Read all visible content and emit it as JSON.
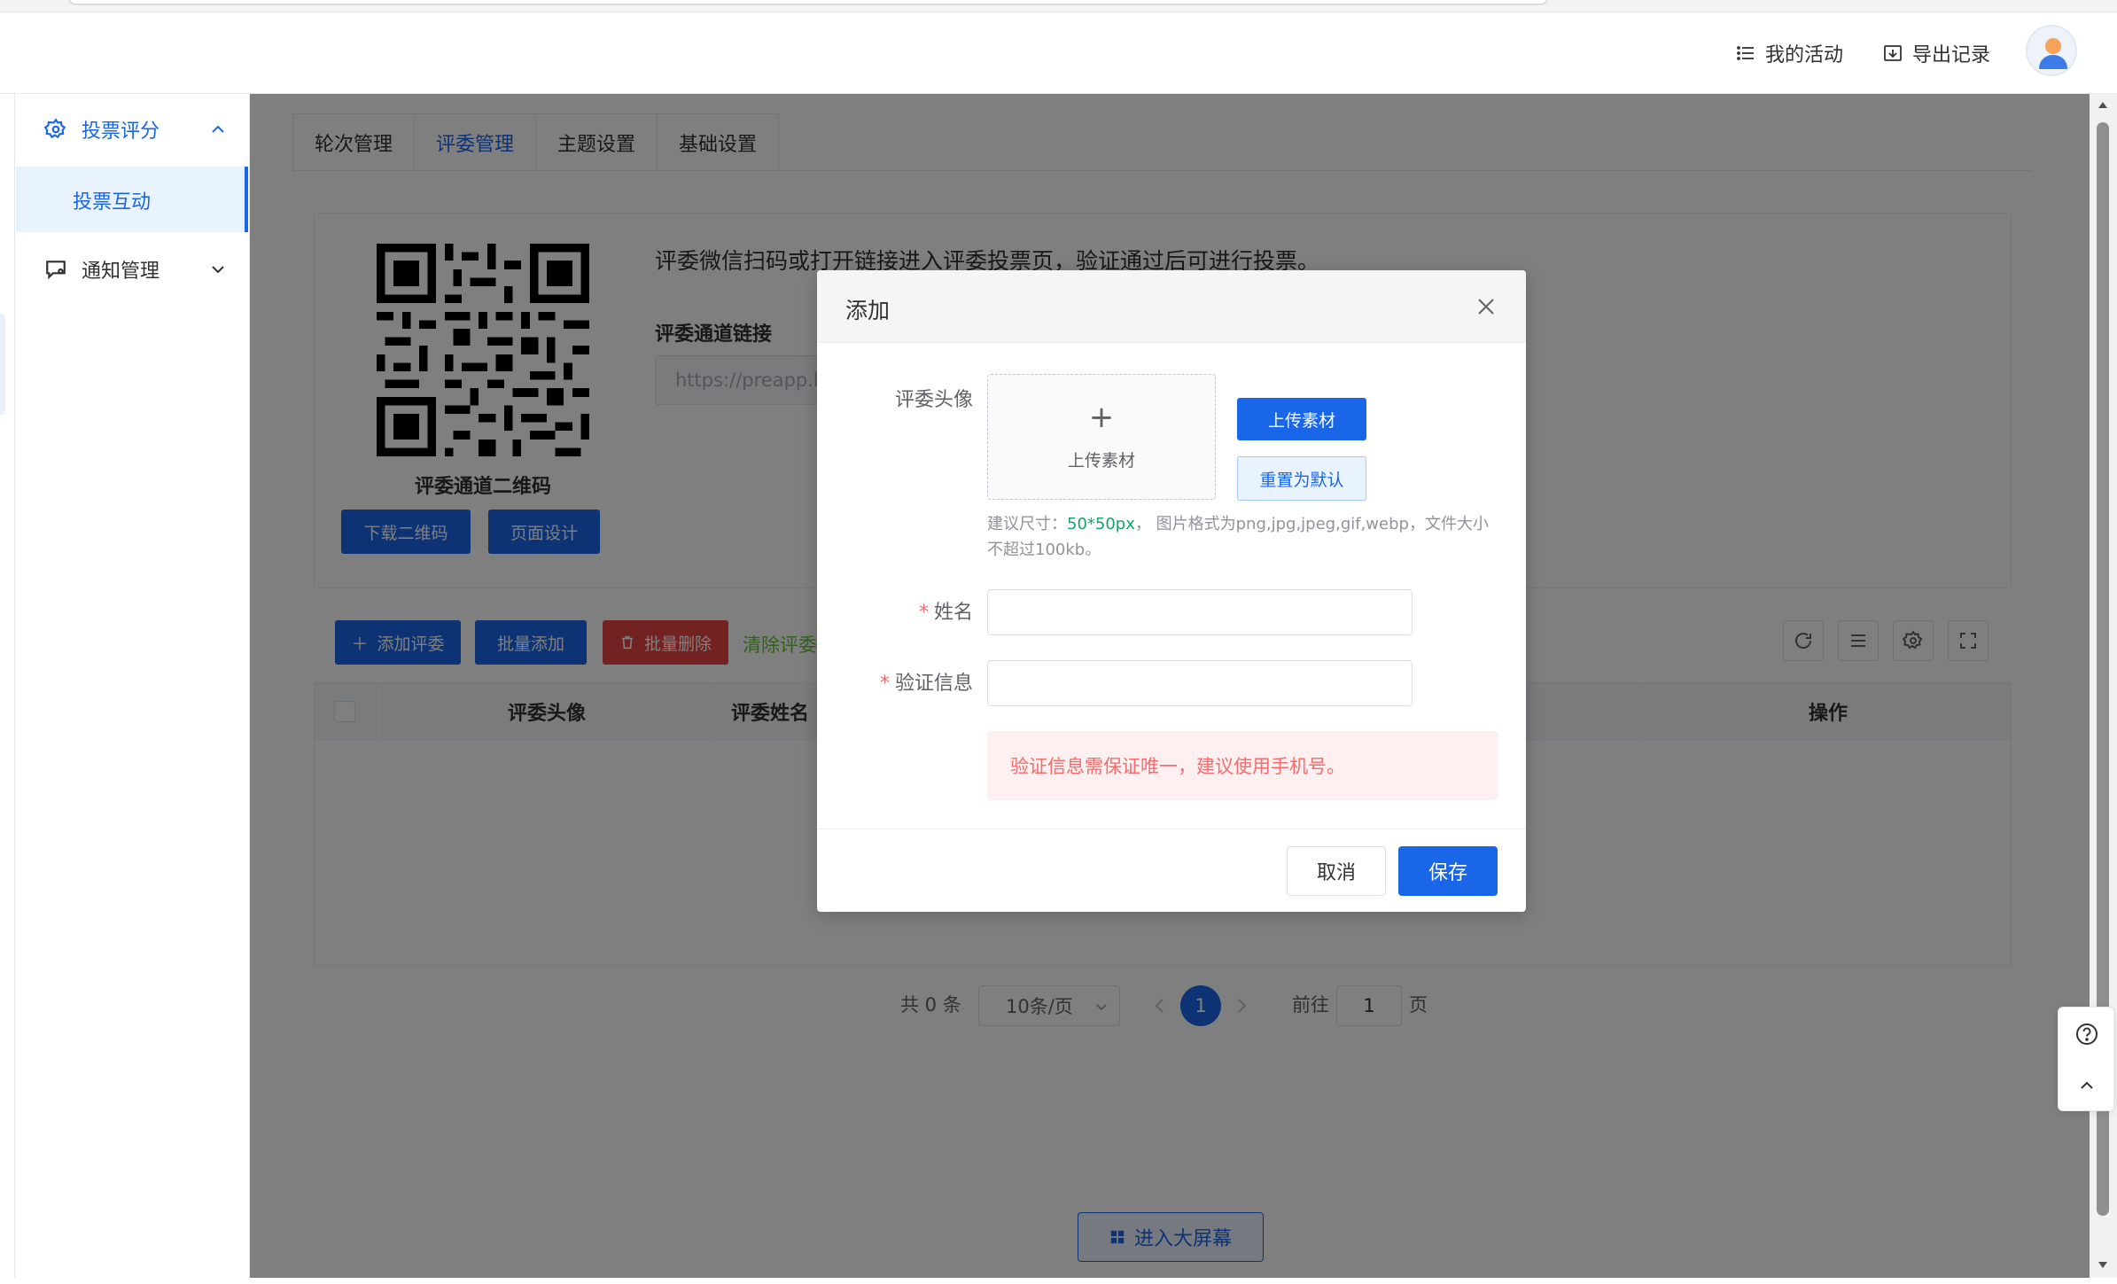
{
  "header": {
    "my_activity": "我的活动",
    "export_records": "导出记录"
  },
  "sidebar": {
    "groups": [
      {
        "label": "投票评分",
        "icon": "gear-icon",
        "expanded": true,
        "items": [
          {
            "label": "投票互动",
            "active": true
          }
        ]
      },
      {
        "label": "通知管理",
        "icon": "notice-icon",
        "expanded": false
      }
    ]
  },
  "tabs": [
    {
      "label": "轮次管理"
    },
    {
      "label": "评委管理",
      "active": true
    },
    {
      "label": "主题设置"
    },
    {
      "label": "基础设置"
    }
  ],
  "card": {
    "qr_caption": "评委通道二维码",
    "download_qr": "下载二维码",
    "page_design": "页面设计",
    "description": "评委微信扫码或打开链接进入评委投票页，验证通过后可进行投票。",
    "link_label": "评委通道链接",
    "link_value": "https://preapp.h"
  },
  "toolbar": {
    "add_judge": "添加评委",
    "batch_add": "批量添加",
    "batch_delete": "批量删除",
    "clear_judges": "清除评委"
  },
  "table": {
    "columns": [
      "评委头像",
      "评委姓名",
      "操作"
    ]
  },
  "pagination": {
    "total": "共 0 条",
    "page_size": "10条/页",
    "current_page": "1",
    "goto_label": "前往",
    "goto_value": "1",
    "page_unit": "页"
  },
  "big_screen": "进入大屏幕",
  "dialog": {
    "title": "添加",
    "avatar_label": "评委头像",
    "upload_plus": "+",
    "upload_text": "上传素材",
    "upload_button": "上传素材",
    "reset_button": "重置为默认",
    "hint_prefix": "建议尺寸：",
    "hint_size": "50*50px",
    "hint_suffix": "， 图片格式为png,jpg,jpeg,gif,webp，文件大小不超过100kb。",
    "required_mark": "*",
    "name_label": "姓名",
    "name_value": "",
    "verify_label": "验证信息",
    "verify_value": "",
    "alert": "验证信息需保证唯一，建议使用手机号。",
    "cancel": "取消",
    "save": "保存"
  },
  "colors": {
    "primary": "#1a66e8",
    "danger": "#e64545",
    "success": "#67c23a",
    "alert_bg": "#fef0f0",
    "alert_text": "#f56c6c"
  }
}
